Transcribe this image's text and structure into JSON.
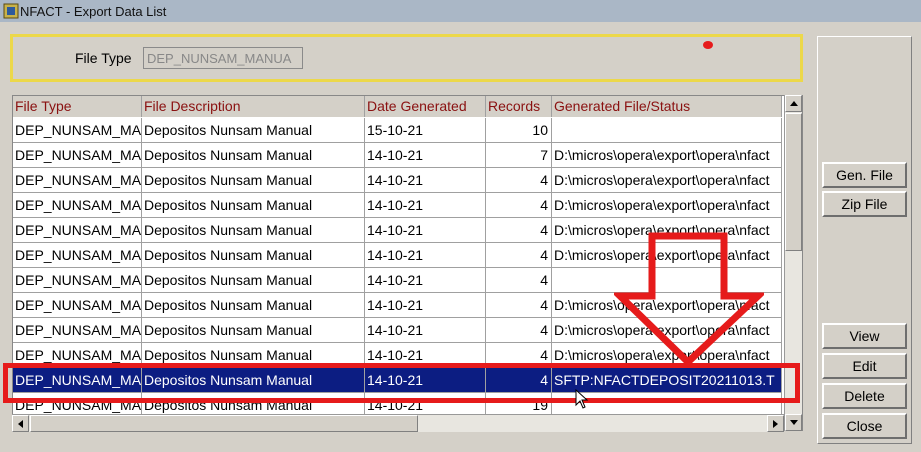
{
  "window": {
    "title": "NFACT - Export Data List"
  },
  "filter": {
    "label": "File Type",
    "value": "DEP_NUNSAM_MANUA"
  },
  "table": {
    "headers": [
      "File Type",
      "File Description",
      "Date Generated",
      "Records",
      "Generated File/Status"
    ],
    "rows": [
      {
        "type": "DEP_NUNSAM_MA",
        "desc": "Depositos Nunsam  Manual",
        "date": "15-10-21",
        "records": "10",
        "file": ""
      },
      {
        "type": "DEP_NUNSAM_MA",
        "desc": "Depositos Nunsam  Manual",
        "date": "14-10-21",
        "records": "7",
        "file": "D:\\micros\\opera\\export\\opera\\nfact"
      },
      {
        "type": "DEP_NUNSAM_MA",
        "desc": "Depositos Nunsam  Manual",
        "date": "14-10-21",
        "records": "4",
        "file": "D:\\micros\\opera\\export\\opera\\nfact"
      },
      {
        "type": "DEP_NUNSAM_MA",
        "desc": "Depositos Nunsam  Manual",
        "date": "14-10-21",
        "records": "4",
        "file": "D:\\micros\\opera\\export\\opera\\nfact"
      },
      {
        "type": "DEP_NUNSAM_MA",
        "desc": "Depositos Nunsam  Manual",
        "date": "14-10-21",
        "records": "4",
        "file": "D:\\micros\\opera\\export\\opera\\nfact"
      },
      {
        "type": "DEP_NUNSAM_MA",
        "desc": "Depositos Nunsam  Manual",
        "date": "14-10-21",
        "records": "4",
        "file": "D:\\micros\\opera\\export\\opera\\nfact"
      },
      {
        "type": "DEP_NUNSAM_MA",
        "desc": "Depositos Nunsam  Manual",
        "date": "14-10-21",
        "records": "4",
        "file": ""
      },
      {
        "type": "DEP_NUNSAM_MA",
        "desc": "Depositos Nunsam  Manual",
        "date": "14-10-21",
        "records": "4",
        "file": "D:\\micros\\opera\\export\\opera\\nfact"
      },
      {
        "type": "DEP_NUNSAM_MA",
        "desc": "Depositos Nunsam  Manual",
        "date": "14-10-21",
        "records": "4",
        "file": "D:\\micros\\opera\\export\\opera\\nfact"
      },
      {
        "type": "DEP_NUNSAM_MA",
        "desc": "Depositos Nunsam  Manual",
        "date": "14-10-21",
        "records": "4",
        "file": "D:\\micros\\opera\\export\\opera\\nfact"
      },
      {
        "type": "DEP_NUNSAM_MA",
        "desc": "Depositos Nunsam  Manual",
        "date": "14-10-21",
        "records": "4",
        "file": "SFTP:NFACTDEPOSIT20211013.T"
      },
      {
        "type": "DEP_NUNSAM_MA",
        "desc": "Depositos Nunsam  Manual",
        "date": "14-10-21",
        "records": "19",
        "file": ""
      }
    ],
    "selected_index": 10
  },
  "buttons": {
    "gen_file": "Gen. File",
    "zip_file": "Zip File",
    "view": "View",
    "edit": "Edit",
    "delete": "Delete",
    "close": "Close"
  },
  "colors": {
    "title_bar": "#aab7c6",
    "header_text": "#8a1010",
    "selected_row": "#0c1d82",
    "annotation_red": "#e61b1b",
    "filter_border": "#ecd84a"
  }
}
